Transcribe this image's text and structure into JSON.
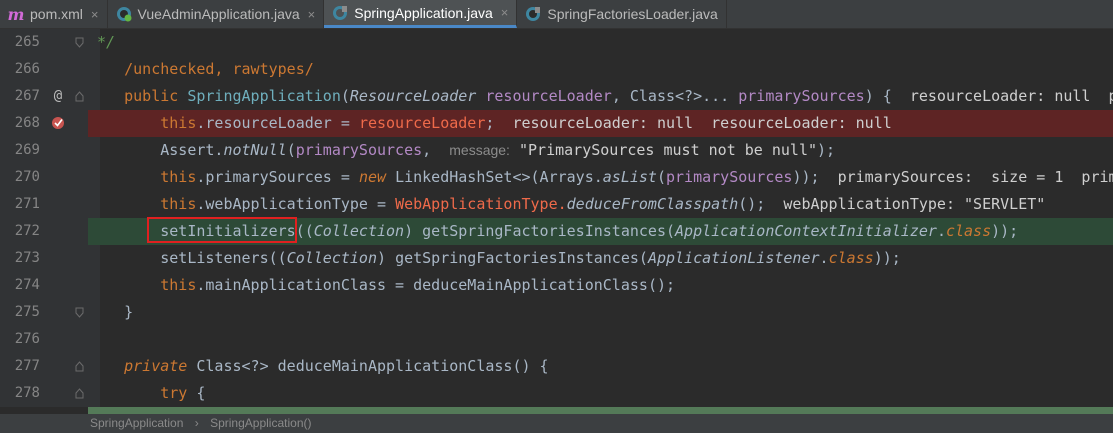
{
  "tabs": [
    {
      "label": "pom.xml",
      "icon": "maven-icon",
      "active": false
    },
    {
      "label": "VueAdminApplication.java",
      "icon": "java-class-icon",
      "active": false
    },
    {
      "label": "SpringApplication.java",
      "icon": "java-class-icon",
      "active": true
    },
    {
      "label": "SpringFactoriesLoader.java",
      "icon": "java-class-icon",
      "active": false
    }
  ],
  "tab_icon_letter": "m",
  "close_glyph": "×",
  "lines": {
    "n265": "265",
    "n266": "266",
    "n267": "267",
    "n268": "268",
    "n269": "269",
    "n270": "270",
    "n271": "271",
    "n272": "272",
    "n273": "273",
    "n274": "274",
    "n275": "275",
    "n276": "276",
    "n277": "277",
    "n278": "278"
  },
  "code": {
    "l265": " */",
    "l266_ann": "/unchecked, rawtypes/",
    "l267_kw": "public",
    "l267_name": "SpringApplication",
    "l267_t1": "ResourceLoader",
    "l267_p1": "resourceLoader",
    "l267_t2": "Class<?>...",
    "l267_p2": "primarySources",
    "l267_tail": ") {",
    "l267_hint": "resourceLoader: null  p",
    "l268_this": "this",
    "l268_field": "resourceLoader",
    "l268_assign": " = ",
    "l268_param": "resourceLoader",
    "l268_semi": ";",
    "l268_hint": "resourceLoader: null  resourceLoader: null",
    "l269_cls": "Assert.",
    "l269_m": "notNull",
    "l269_p": "primarySources",
    "l269_hint": "message:",
    "l269_str": "\"PrimarySources must not be null\"",
    "l269_tail": ");",
    "l270_this": "this",
    "l270_field": "primarySources",
    "l270_new": "new",
    "l270_cls": "LinkedHashSet<>(Arrays.",
    "l270_m": "asList",
    "l270_p": "primarySources",
    "l270_tail": "));",
    "l270_hint": "primarySources:  size = 1  prim",
    "l271_this": "this",
    "l271_field": "webApplicationType",
    "l271_cls": "WebApplicationType.",
    "l271_m": "deduceFromClasspath",
    "l271_tail": "();",
    "l271_hint": "webApplicationType: \"SERVLET\"",
    "l272_m": "setInitializers",
    "l272_cast": "Collection",
    "l272_call": "getSpringFactoriesInstances",
    "l272_arg": "ApplicationContextInitializer",
    "l272_class": "class",
    "l272_tail": "));",
    "l273_m": "setListeners",
    "l273_cast": "Collection",
    "l273_call": "getSpringFactoriesInstances",
    "l273_arg": "ApplicationListener",
    "l273_class": "class",
    "l273_tail": "));",
    "l274_this": "this",
    "l274_field": "mainApplicationClass",
    "l274_call": "deduceMainApplicationClass",
    "l274_tail": "();",
    "l275": "}",
    "l277_kw": "private",
    "l277_rest": "Class<?> deduceMainApplicationClass() {",
    "l278_kw": "try",
    "l278_tail": " {"
  },
  "breadcrumb": {
    "item1": "SpringApplication",
    "sep": "›",
    "item2": "SpringApplication()"
  },
  "colors": {
    "editor_bg": "#2b2b2b",
    "breakpoint_line": "#5e2424",
    "execution_line": "#2d4a37",
    "highlight_box": "#e02020",
    "accent_tab": "#4a88c7"
  }
}
